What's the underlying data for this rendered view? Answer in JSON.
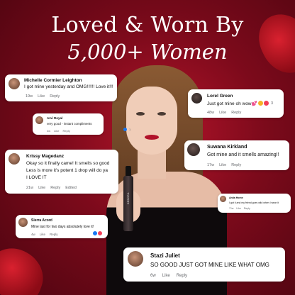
{
  "headline": {
    "line1": "Loved & Worn By",
    "line2": "5,000+ Women"
  },
  "product": {
    "label": "DEBORA"
  },
  "reviews": [
    {
      "name": "Michelle Cormier Leighton",
      "text": "I got mine yesterday and OMG!!!!!! Love it!!!",
      "time": "19w",
      "like": "Like",
      "reply": "Reply"
    },
    {
      "name": "Arvi Royal",
      "text": "very good - instant compliments",
      "time": "4w",
      "like": "Like",
      "reply": "Reply",
      "reaction_count": "1"
    },
    {
      "name": "Krissy Magedanz",
      "lines": [
        "Okay so it finally came! It smells so good",
        "Less is more it's potent 1 drop will do ya",
        "I LOVE IT"
      ],
      "time": "21w",
      "like": "Like",
      "reply": "Reply",
      "edited": "Edited"
    },
    {
      "name": "Sierra Acord",
      "text": "Mine last for two days absolutely love it!",
      "time": "4w",
      "like": "Like",
      "reply": "Reply"
    },
    {
      "name": "Lorel Green",
      "text": "Just got mine oh wow💕",
      "time": "48w",
      "like": "Like",
      "reply": "Reply",
      "reaction_count": "3"
    },
    {
      "name": "Suwana Kirkland",
      "text": "Got mine and it smells amazing!!",
      "time": "17w",
      "like": "Like",
      "reply": "Reply"
    },
    {
      "name": "Anita Horne",
      "text": "I got it and my friend goes wild when I wear it",
      "time": "71w",
      "like": "Like",
      "reply": "Reply"
    },
    {
      "name": "Stazi Juliet",
      "text": "SO GOOD JUST GOT MINE LIKE WHAT OMG",
      "time": "6w",
      "like": "Like",
      "reply": "Reply"
    }
  ],
  "colors": {
    "background": "#8a0c1e",
    "like_blue": "#1877f2",
    "love_red": "#f33e58",
    "haha_yellow": "#f7b125"
  }
}
